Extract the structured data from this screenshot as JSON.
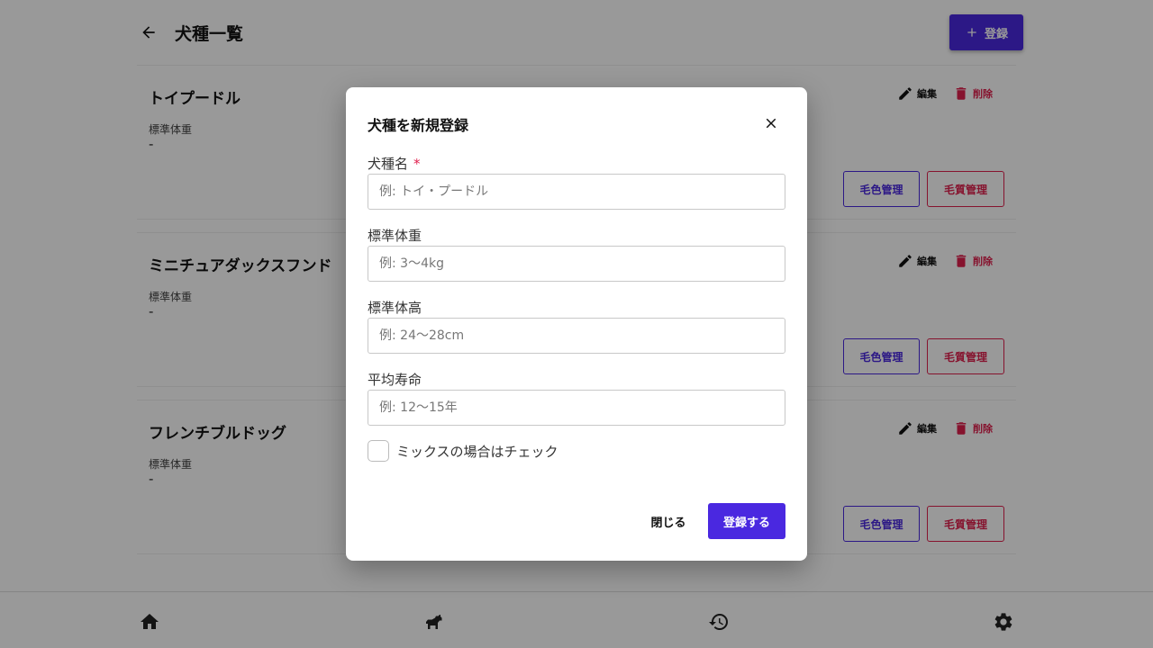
{
  "header": {
    "title": "犬種一覧",
    "add_button_label": "登録"
  },
  "breeds": [
    {
      "name": "トイプードル",
      "weight_label": "標準体重",
      "weight_value": "-",
      "edit_label": "編集",
      "delete_label": "削除",
      "color_button": "毛色管理",
      "quality_button": "毛質管理"
    },
    {
      "name": "ミニチュアダックスフンド",
      "weight_label": "標準体重",
      "weight_value": "-",
      "edit_label": "編集",
      "delete_label": "削除",
      "color_button": "毛色管理",
      "quality_button": "毛質管理"
    },
    {
      "name": "フレンチブルドッグ",
      "weight_label": "標準体重",
      "weight_value": "-",
      "edit_label": "編集",
      "delete_label": "削除",
      "color_button": "毛色管理",
      "quality_button": "毛質管理"
    }
  ],
  "modal": {
    "title": "犬種を新規登録",
    "fields": [
      {
        "label": "犬種名",
        "required_mark": "*",
        "placeholder": "例: トイ・プードル",
        "value": ""
      },
      {
        "label": "標準体重",
        "placeholder": "例: 3〜4kg",
        "value": ""
      },
      {
        "label": "標準体高",
        "placeholder": "例: 24〜28cm",
        "value": ""
      },
      {
        "label": "平均寿命",
        "placeholder": "例: 12〜15年",
        "value": ""
      }
    ],
    "mix_checkbox": {
      "label": "ミックスの場合はチェック",
      "checked": false
    },
    "close_label": "閉じる",
    "submit_label": "登録する"
  },
  "bottom_nav": {
    "items": [
      {
        "icon": "home-icon"
      },
      {
        "icon": "dog-icon"
      },
      {
        "icon": "history-icon"
      },
      {
        "icon": "settings-icon"
      }
    ]
  },
  "colors": {
    "primary": "#4a28e0",
    "danger": "#e0204e",
    "overlay": "rgba(0,0,0,0.4)"
  }
}
